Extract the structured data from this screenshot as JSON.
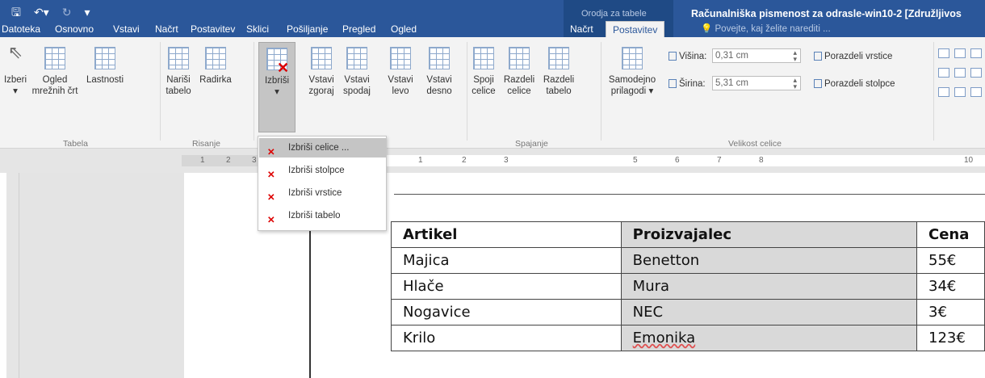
{
  "quick_access": {
    "save_icon": "save-icon",
    "undo_icon": "undo-icon",
    "redo_icon": "redo-icon",
    "customize_icon": "customize-qat-icon"
  },
  "context_header": "Orodja za tabele",
  "doc_title": "Računalniška pismenost za odrasle-win10-2 [Združljivos",
  "tabs": [
    "Datoteka",
    "Osnovno",
    "Vstavi",
    "Načrt",
    "Postavitev",
    "Sklici",
    "Pošiljanje",
    "Pregled",
    "Ogled",
    "Načrt",
    "Postavitev"
  ],
  "tell_me": "Povejte, kaj želite narediti ...",
  "ribbon": {
    "groups": {
      "tabela": "Tabela",
      "risanje": "Risanje",
      "spajanje": "Spajanje",
      "velikost": "Velikost celice"
    },
    "buttons": {
      "izberi": "Izberi",
      "ogled": "Ogled mrežnih črt",
      "lastnosti": "Lastnosti",
      "narisi": "Nariši tabelo",
      "radirka": "Radirka",
      "izbrisi": "Izbriši",
      "vstavi_zgoraj": "Vstavi zgoraj",
      "vstavi_spodaj": "Vstavi spodaj",
      "vstavi_levo": "Vstavi levo",
      "vstavi_desno": "Vstavi desno",
      "spoji": "Spoji celice",
      "razdeli_celice": "Razdeli celice",
      "razdeli_tabelo": "Razdeli tabelo",
      "samodejno": "Samodejno prilagodi"
    },
    "cell_size": {
      "visina_label": "Višina:",
      "visina_value": "0,31 cm",
      "sirina_label": "Širina:",
      "sirina_value": "5,31 cm",
      "porazdeli_vrstice": "Porazdeli vrstice",
      "porazdeli_stolpce": "Porazdeli stolpce"
    }
  },
  "dropdown": [
    "Izbriši celice ...",
    "Izbriši stolpce",
    "Izbriši vrstice",
    "Izbriši tabelo"
  ],
  "ruler": [
    "1",
    "2",
    "3",
    "1",
    "2",
    "3",
    "5",
    "6",
    "7",
    "8",
    "10"
  ],
  "table": {
    "header": [
      "Artikel",
      "Proizvajalec",
      "Cena"
    ],
    "rows": [
      [
        "Majica",
        "Benetton",
        "55€"
      ],
      [
        "Hlače",
        "Mura",
        "34€"
      ],
      [
        "Nogavice",
        "NEC",
        "3€"
      ],
      [
        "Krilo",
        "Emonika",
        "123€"
      ]
    ]
  }
}
